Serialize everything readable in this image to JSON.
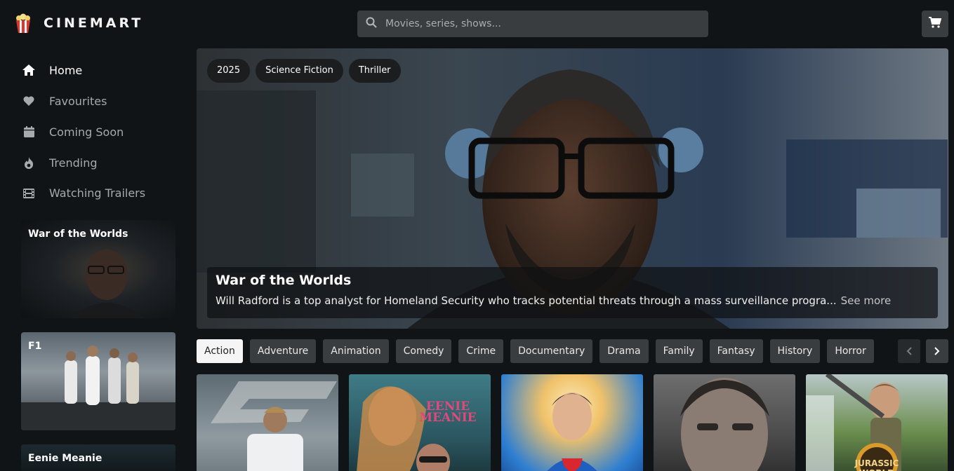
{
  "brand": {
    "name": "CINEMART"
  },
  "search": {
    "placeholder": "Movies, series, shows..."
  },
  "nav": {
    "items": [
      {
        "label": "Home",
        "icon": "home-icon"
      },
      {
        "label": "Favourites",
        "icon": "heart-icon"
      },
      {
        "label": "Coming Soon",
        "icon": "calendar-icon"
      },
      {
        "label": "Trending",
        "icon": "flame-icon"
      }
    ],
    "trailers_label": "Watching Trailers"
  },
  "trailers": [
    {
      "title": "War of the Worlds"
    },
    {
      "title": "F1"
    },
    {
      "title": "Eenie Meanie"
    }
  ],
  "hero": {
    "tags": [
      "2025",
      "Science Fiction",
      "Thriller"
    ],
    "title": "War of the Worlds",
    "description": "Will Radford is a top analyst for Homeland Security who tracks potential threats through a mass surveillance progra...",
    "see_more": "See more"
  },
  "genres": [
    "Action",
    "Adventure",
    "Animation",
    "Comedy",
    "Crime",
    "Documentary",
    "Drama",
    "Family",
    "Fantasy",
    "History",
    "Horror"
  ],
  "active_genre": "Action",
  "posters": [
    {
      "alt": "F1",
      "accent": "#4a5a66"
    },
    {
      "alt": "Eenie Meanie",
      "poster_text": "EENIE MEANIE",
      "accent": "#3f7c86"
    },
    {
      "alt": "Superman",
      "accent": "#2f7fd1"
    },
    {
      "alt": "Mission: Impossible",
      "accent": "#444444"
    },
    {
      "alt": "Jurassic World",
      "poster_text": "JURASSIC WORLD",
      "accent": "#6b8e4e"
    }
  ]
}
